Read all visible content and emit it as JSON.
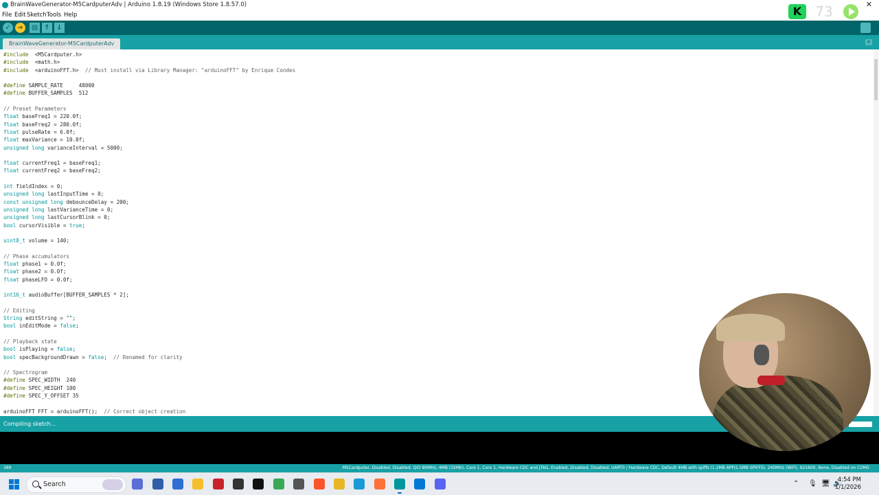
{
  "window": {
    "title": "BrainWaveGenerator-M5CardputerAdv | Arduino 1.8.19 (Windows Store 1.8.57.0)",
    "close_glyph": "✕"
  },
  "menu": [
    "File",
    "Edit",
    "Sketch",
    "Tools",
    "Help"
  ],
  "overlay": {
    "badge": "K",
    "counter": "73"
  },
  "toolbar": {
    "verify": "✓",
    "upload": "➔",
    "new": "▤",
    "open": "↑",
    "save": "↓"
  },
  "tabs": [
    {
      "label": "BrainWaveGenerator-M5CardputerAdv"
    }
  ],
  "tab_menu_glyph": "▾",
  "code_lines": [
    [
      [
        "pp",
        "#include"
      ],
      [
        "",
        "  <M5Cardputer.h>"
      ]
    ],
    [
      [
        "pp",
        "#include"
      ],
      [
        "",
        "  <math.h>"
      ]
    ],
    [
      [
        "pp",
        "#include"
      ],
      [
        "",
        "  <arduinoFFT.h>  "
      ],
      [
        "cm",
        "// Must install via Library Manager: \"arduinoFFT\" by Enrique Condes"
      ]
    ],
    [],
    [
      [
        "pp",
        "#define"
      ],
      [
        "",
        " SAMPLE_RATE     48000"
      ]
    ],
    [
      [
        "pp",
        "#define"
      ],
      [
        "",
        " BUFFER_SAMPLES  512"
      ]
    ],
    [],
    [
      [
        "cm",
        "// Preset Parameters"
      ]
    ],
    [
      [
        "ty",
        "float"
      ],
      [
        "",
        " baseFreq1 = 220.0f;"
      ]
    ],
    [
      [
        "ty",
        "float"
      ],
      [
        "",
        " baseFreq2 = 280.0f;"
      ]
    ],
    [
      [
        "ty",
        "float"
      ],
      [
        "",
        " pulseRate = 6.0f;"
      ]
    ],
    [
      [
        "ty",
        "float"
      ],
      [
        "",
        " maxVariance = 10.0f;"
      ]
    ],
    [
      [
        "ty",
        "unsigned long"
      ],
      [
        "",
        " varianceInterval = 5000;"
      ]
    ],
    [],
    [
      [
        "ty",
        "float"
      ],
      [
        "",
        " currentFreq1 = baseFreq1;"
      ]
    ],
    [
      [
        "ty",
        "float"
      ],
      [
        "",
        " currentFreq2 = baseFreq2;"
      ]
    ],
    [],
    [
      [
        "ty",
        "int"
      ],
      [
        "",
        " fieldIndex = 0;"
      ]
    ],
    [
      [
        "ty",
        "unsigned long"
      ],
      [
        "",
        " lastInputTime = 0;"
      ]
    ],
    [
      [
        "ty",
        "const unsigned long"
      ],
      [
        "",
        " debounceDelay = 200;"
      ]
    ],
    [
      [
        "ty",
        "unsigned long"
      ],
      [
        "",
        " lastVarianceTime = 0;"
      ]
    ],
    [
      [
        "ty",
        "unsigned long"
      ],
      [
        "",
        " lastCursorBlink = 0;"
      ]
    ],
    [
      [
        "ty",
        "bool"
      ],
      [
        "",
        " cursorVisible = "
      ],
      [
        "kw",
        "true"
      ],
      [
        "",
        ";"
      ]
    ],
    [],
    [
      [
        "ty",
        "uint8_t"
      ],
      [
        "",
        " volume = 140;"
      ]
    ],
    [],
    [
      [
        "cm",
        "// Phase accumulators"
      ]
    ],
    [
      [
        "ty",
        "float"
      ],
      [
        "",
        " phase1 = 0.0f;"
      ]
    ],
    [
      [
        "ty",
        "float"
      ],
      [
        "",
        " phase2 = 0.0f;"
      ]
    ],
    [
      [
        "ty",
        "float"
      ],
      [
        "",
        " phaseLFO = 0.0f;"
      ]
    ],
    [],
    [
      [
        "ty",
        "int16_t"
      ],
      [
        "",
        " audioBuffer[BUFFER_SAMPLES * 2];"
      ]
    ],
    [],
    [
      [
        "cm",
        "// Editing"
      ]
    ],
    [
      [
        "ty",
        "String"
      ],
      [
        "",
        " editString = "
      ],
      [
        "str",
        "\"\""
      ],
      [
        "",
        ";"
      ]
    ],
    [
      [
        "ty",
        "bool"
      ],
      [
        "",
        " inEditMode = "
      ],
      [
        "kw",
        "false"
      ],
      [
        "",
        ";"
      ]
    ],
    [],
    [
      [
        "cm",
        "// Playback state"
      ]
    ],
    [
      [
        "ty",
        "bool"
      ],
      [
        "",
        " isPlaying = "
      ],
      [
        "kw",
        "false"
      ],
      [
        "",
        ";"
      ]
    ],
    [
      [
        "ty",
        "bool"
      ],
      [
        "",
        " specBackgroundDrawn = "
      ],
      [
        "kw",
        "false"
      ],
      [
        "",
        ";  "
      ],
      [
        "cm",
        "// Renamed for clarity"
      ]
    ],
    [],
    [
      [
        "cm",
        "// Spectrogram"
      ]
    ],
    [
      [
        "pp",
        "#define"
      ],
      [
        "",
        " SPEC_WIDTH  240"
      ]
    ],
    [
      [
        "pp",
        "#define"
      ],
      [
        "",
        " SPEC_HEIGHT 100"
      ]
    ],
    [
      [
        "pp",
        "#define"
      ],
      [
        "",
        " SPEC_Y_OFFSET 35"
      ]
    ],
    [],
    [
      [
        "",
        "arduinoFFT FFT = arduinoFFT();  "
      ],
      [
        "cm",
        "// Correct object creation"
      ]
    ]
  ],
  "status": {
    "message": "Compiling sketch...",
    "progress": 0.0
  },
  "infobar": {
    "line_number": "389",
    "board": "M5Cardputer, Disabled, Disabled, QIO 80MHz, 4MB (32Mb), Core 1, Core 1, Hardware CDC and JTAG, Enabled, Disabled, Disabled, UART0 / Hardware CDC, Default 4MB with spiffs (1.2MB APP/1.5MB SPIFFS), 240MHz (WiFi), 921600, None, Disabled on COM5"
  },
  "taskbar": {
    "search_label": "Search",
    "time": "4:54 PM",
    "date": "1/1/2026",
    "tray_chevron": "⌃",
    "icons": [
      {
        "name": "copilot-app-icon",
        "color": "#5b6fd6"
      },
      {
        "name": "phone-link-icon",
        "color": "#2f5fa8"
      },
      {
        "name": "app-r-icon",
        "color": "#2d6fd2"
      },
      {
        "name": "file-explorer-icon",
        "color": "#f4bf2a"
      },
      {
        "name": "news-app-icon",
        "color": "#c8232b"
      },
      {
        "name": "clock-app-icon",
        "color": "#333333"
      },
      {
        "name": "capcut-icon",
        "color": "#111111"
      },
      {
        "name": "maps-app-icon",
        "color": "#3aa757"
      },
      {
        "name": "settings-icon",
        "color": "#555555"
      },
      {
        "name": "brave-icon",
        "color": "#fb542b"
      },
      {
        "name": "chrome-icon",
        "color": "#e9b526"
      },
      {
        "name": "edge-icon",
        "color": "#1a9ad6"
      },
      {
        "name": "firefox-icon",
        "color": "#ff7139"
      },
      {
        "name": "arduino-icon",
        "color": "#00979c"
      },
      {
        "name": "vscode-icon",
        "color": "#0078d4"
      },
      {
        "name": "discord-icon",
        "color": "#5865f2"
      }
    ]
  },
  "colors": {
    "toolbar": "#006468",
    "tabrow": "#17a1a5",
    "keyword": "#00979c"
  }
}
